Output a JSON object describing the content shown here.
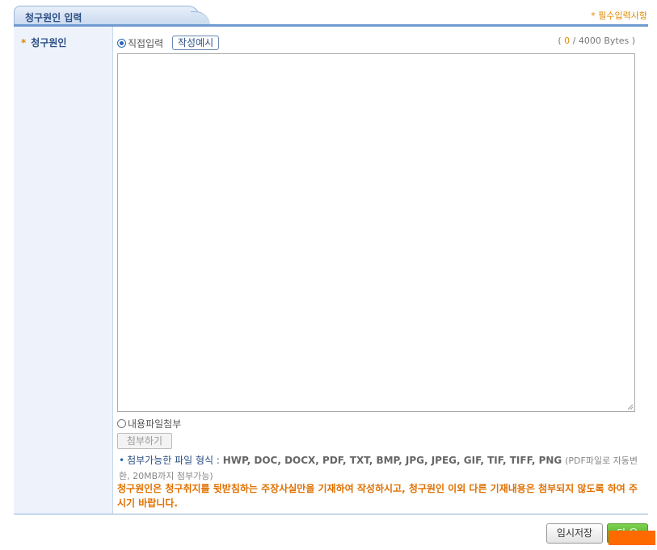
{
  "header": {
    "tab_title": "청구원인 입력",
    "required_note": "* 필수입력사항"
  },
  "form": {
    "field_label_star": "*",
    "field_label": "청구원인",
    "direct_input_label": "직접입력",
    "direct_input_selected": true,
    "example_button": "작성예시",
    "byte_count_open": "(",
    "byte_count_current": "0",
    "byte_count_max": "/ 4000 Bytes )",
    "content_value": "",
    "file_attach_label": "내용파일첨부",
    "file_attach_selected": false,
    "attach_button": "첨부하기",
    "formats_label": "첨부가능한 파일 형식 :",
    "formats_list": "HWP, DOC, DOCX, PDF, TXT, BMP, JPG, JPEG, GIF, TIF, TIFF, PNG",
    "formats_note": "(PDF파일로 자동변환, 20MB까지 첨부가능)",
    "warning": "청구원인은 청구취지를 뒷받침하는 주장사실만을 기재하여 작성하시고, 청구원인 이외 다른 기재내용은 첨부되지 않도록 하여 주시기 바랍니다."
  },
  "footer": {
    "save_button": "임시저장",
    "next_button": "다 음"
  },
  "colors": {
    "accent_blue": "#2c4f84",
    "orange": "#e08a00",
    "next_green": "#3fa11c"
  }
}
